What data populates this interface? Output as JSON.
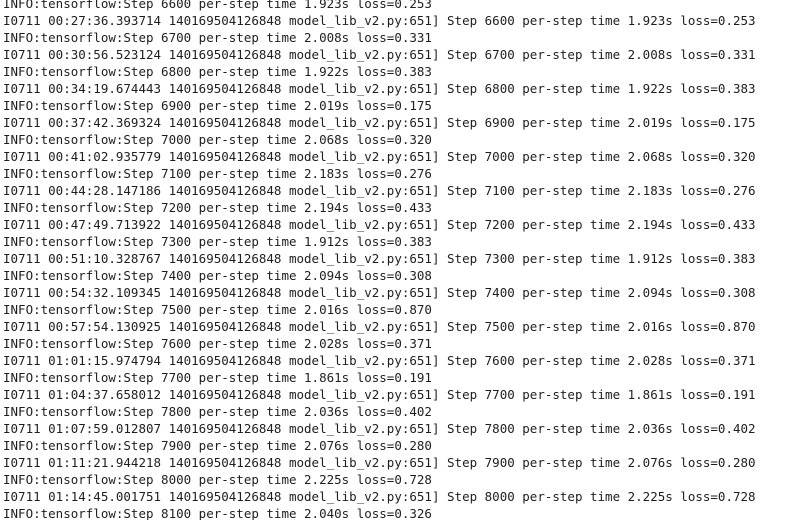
{
  "console": {
    "top_clipped_line": "INFO:tensorflow:Step 6600 per-step time 1.923s loss=0.253",
    "lines": [
      "INFO:tensorflow:Step 6600 per-step time 1.923s loss=0.253",
      "I0711 00:27:36.393714 140169504126848 model_lib_v2.py:651] Step 6600 per-step time 1.923s loss=0.253",
      "INFO:tensorflow:Step 6700 per-step time 2.008s loss=0.331",
      "I0711 00:30:56.523124 140169504126848 model_lib_v2.py:651] Step 6700 per-step time 2.008s loss=0.331",
      "INFO:tensorflow:Step 6800 per-step time 1.922s loss=0.383",
      "I0711 00:34:19.674443 140169504126848 model_lib_v2.py:651] Step 6800 per-step time 1.922s loss=0.383",
      "INFO:tensorflow:Step 6900 per-step time 2.019s loss=0.175",
      "I0711 00:37:42.369324 140169504126848 model_lib_v2.py:651] Step 6900 per-step time 2.019s loss=0.175",
      "INFO:tensorflow:Step 7000 per-step time 2.068s loss=0.320",
      "I0711 00:41:02.935779 140169504126848 model_lib_v2.py:651] Step 7000 per-step time 2.068s loss=0.320",
      "INFO:tensorflow:Step 7100 per-step time 2.183s loss=0.276",
      "I0711 00:44:28.147186 140169504126848 model_lib_v2.py:651] Step 7100 per-step time 2.183s loss=0.276",
      "INFO:tensorflow:Step 7200 per-step time 2.194s loss=0.433",
      "I0711 00:47:49.713922 140169504126848 model_lib_v2.py:651] Step 7200 per-step time 2.194s loss=0.433",
      "INFO:tensorflow:Step 7300 per-step time 1.912s loss=0.383",
      "I0711 00:51:10.328767 140169504126848 model_lib_v2.py:651] Step 7300 per-step time 1.912s loss=0.383",
      "INFO:tensorflow:Step 7400 per-step time 2.094s loss=0.308",
      "I0711 00:54:32.109345 140169504126848 model_lib_v2.py:651] Step 7400 per-step time 2.094s loss=0.308",
      "INFO:tensorflow:Step 7500 per-step time 2.016s loss=0.870",
      "I0711 00:57:54.130925 140169504126848 model_lib_v2.py:651] Step 7500 per-step time 2.016s loss=0.870",
      "INFO:tensorflow:Step 7600 per-step time 2.028s loss=0.371",
      "I0711 01:01:15.974794 140169504126848 model_lib_v2.py:651] Step 7600 per-step time 2.028s loss=0.371",
      "INFO:tensorflow:Step 7700 per-step time 1.861s loss=0.191",
      "I0711 01:04:37.658012 140169504126848 model_lib_v2.py:651] Step 7700 per-step time 1.861s loss=0.191",
      "INFO:tensorflow:Step 7800 per-step time 2.036s loss=0.402",
      "I0711 01:07:59.012807 140169504126848 model_lib_v2.py:651] Step 7800 per-step time 2.036s loss=0.402",
      "INFO:tensorflow:Step 7900 per-step time 2.076s loss=0.280",
      "I0711 01:11:21.944218 140169504126848 model_lib_v2.py:651] Step 7900 per-step time 2.076s loss=0.280",
      "INFO:tensorflow:Step 8000 per-step time 2.225s loss=0.728",
      "I0711 01:14:45.001751 140169504126848 model_lib_v2.py:651] Step 8000 per-step time 2.225s loss=0.728",
      "INFO:tensorflow:Step 8100 per-step time 2.040s loss=0.326"
    ]
  },
  "colors": {
    "background": "#ffffff",
    "text": "#1e1e1e"
  }
}
